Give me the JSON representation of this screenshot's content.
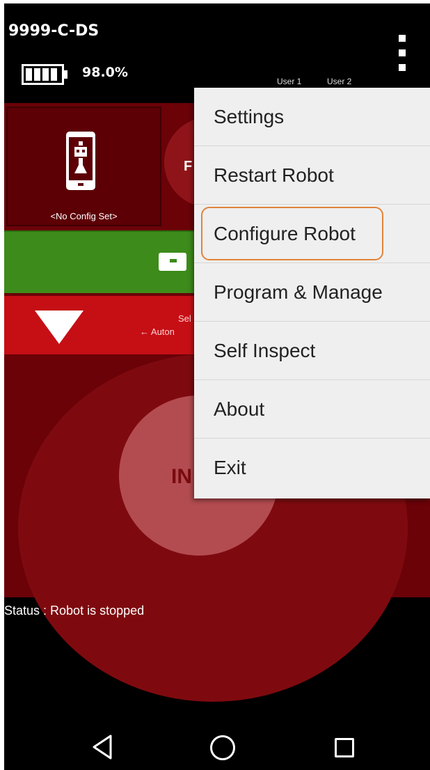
{
  "app": {
    "title": "9999-C-DS",
    "battery_percent": "98.0%",
    "battery_level": 0.98
  },
  "header": {
    "user1": "User 1",
    "user2": "User 2"
  },
  "robot": {
    "config_label": "<No Config Set>",
    "round_button_letter": "F",
    "green_icon": "-",
    "sel_text": "Sel",
    "auto_text": "← Auton",
    "init_text": "IN"
  },
  "status": "Status : Robot is stopped",
  "menu": {
    "items": [
      {
        "label": "Settings"
      },
      {
        "label": "Restart Robot"
      },
      {
        "label": "Configure Robot",
        "highlighted": true
      },
      {
        "label": "Program & Manage"
      },
      {
        "label": "Self Inspect"
      },
      {
        "label": "About"
      },
      {
        "label": "Exit"
      }
    ]
  },
  "colors": {
    "panel": "#6a0208",
    "green_bar": "#3d8b1a",
    "red_bar": "#c50f15",
    "highlight": "#e0833a",
    "menu_bg": "#efefef"
  }
}
